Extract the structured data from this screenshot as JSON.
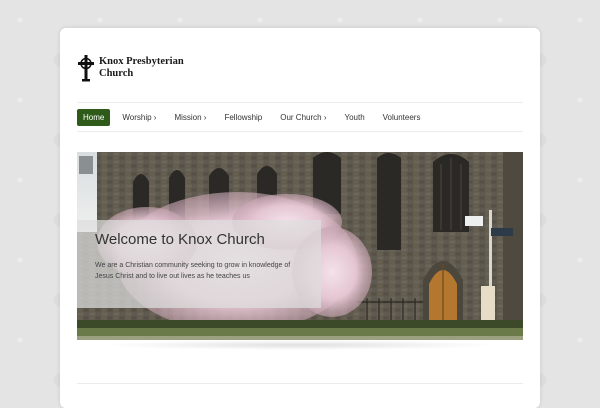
{
  "site": {
    "logo_line1": "Knox Presbyterian",
    "logo_line2": "Church",
    "logo_icon": "celtic-cross-icon"
  },
  "nav": {
    "items": [
      {
        "label": "Home",
        "active": true
      },
      {
        "label": "Worship ›"
      },
      {
        "label": "Mission ›"
      },
      {
        "label": "Fellowship"
      },
      {
        "label": "Our Church ›"
      },
      {
        "label": "Youth"
      },
      {
        "label": "Volunteers"
      }
    ],
    "active_color": "#2f5b1a"
  },
  "hero": {
    "title": "Welcome to Knox Church",
    "text": "We are a Christian community seeking to grow in knowledge of Jesus Christ and to live out lives as he teaches us"
  }
}
